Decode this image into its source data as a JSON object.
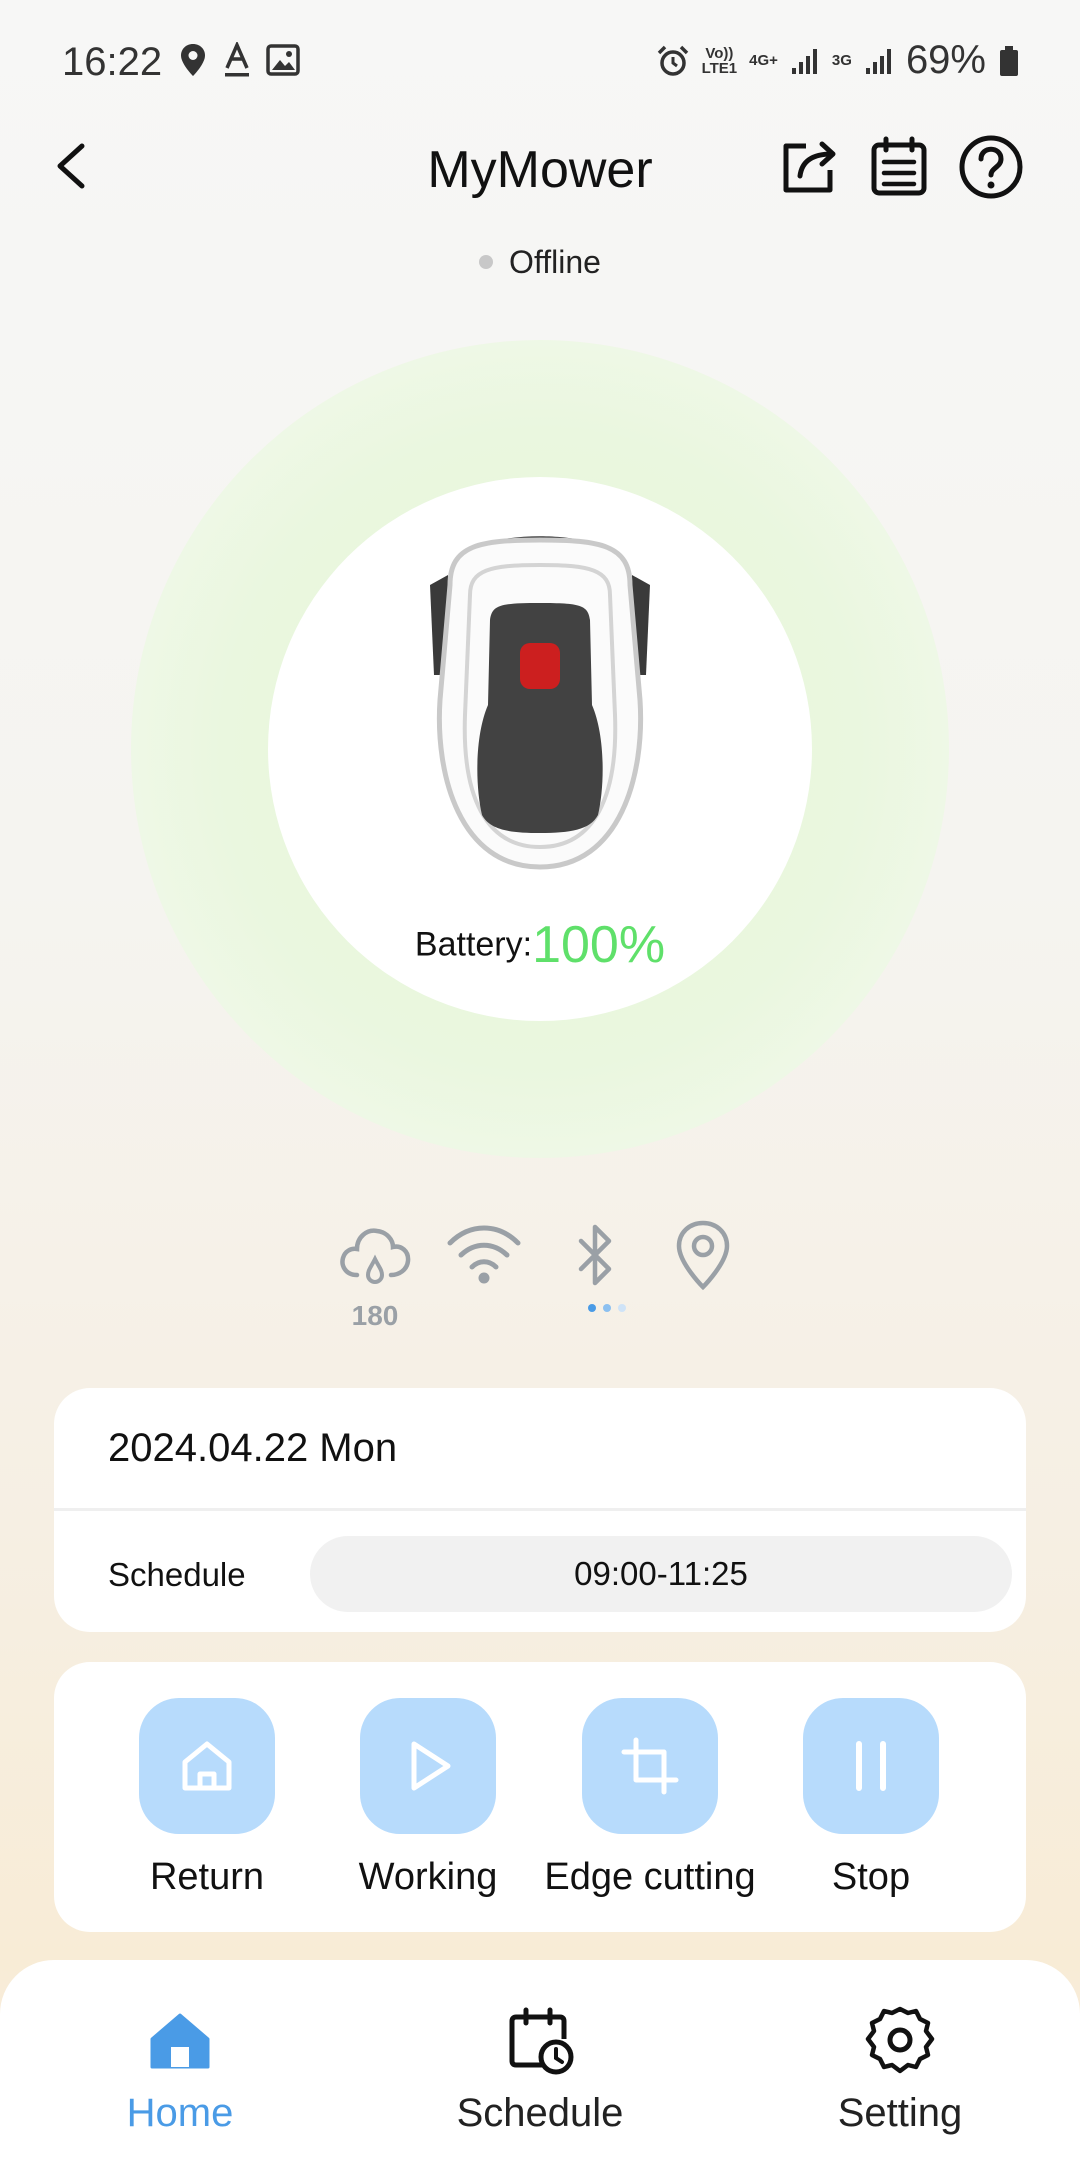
{
  "status_bar": {
    "time": "16:22",
    "net_volte": "Vo))",
    "net_lte": "LTE1",
    "net_4g": "4G+",
    "net_3g": "3G",
    "battery": "69%"
  },
  "header": {
    "title": "MyMower",
    "connection_status": "Offline"
  },
  "mower": {
    "battery_label": "Battery:",
    "battery_value": "100%"
  },
  "connectivity": {
    "rain_value": "180",
    "icons": [
      "rain-cloud-icon",
      "wifi-icon",
      "bluetooth-icon",
      "location-pin-icon"
    ]
  },
  "schedule_card": {
    "date": "2024.04.22 Mon",
    "schedule_label": "Schedule",
    "schedule_time": "09:00-11:25"
  },
  "actions": [
    {
      "label": "Return",
      "icon": "home-icon"
    },
    {
      "label": "Working",
      "icon": "play-icon"
    },
    {
      "label": "Edge cutting",
      "icon": "crop-icon"
    },
    {
      "label": "Stop",
      "icon": "pause-icon"
    }
  ],
  "bottom_nav": [
    {
      "label": "Home",
      "icon": "home-icon",
      "active": true
    },
    {
      "label": "Schedule",
      "icon": "calendar-clock-icon",
      "active": false
    },
    {
      "label": "Setting",
      "icon": "gear-icon",
      "active": false
    }
  ],
  "colors": {
    "accent": "#4a9be6",
    "battery_green": "#5fe06a",
    "action_button": "#b7dbfc"
  }
}
